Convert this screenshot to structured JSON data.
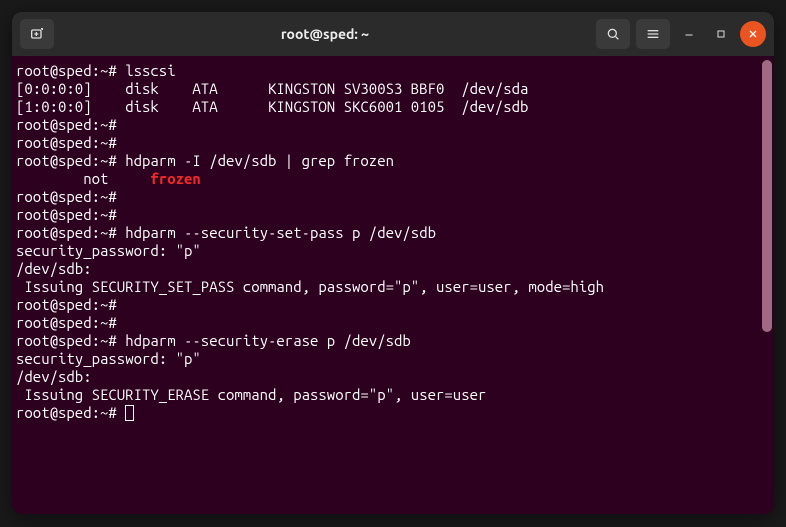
{
  "window": {
    "title": "root@sped: ~"
  },
  "icons": {
    "newtab": "new-tab",
    "search": "search",
    "menu": "menu",
    "minimize": "minimize",
    "maximize": "maximize",
    "close": "close"
  },
  "prompt": "root@sped:~# ",
  "lines": [
    {
      "type": "cmd",
      "text": "lsscsi"
    },
    {
      "type": "out",
      "text": "[0:0:0:0]    disk    ATA      KINGSTON SV300S3 BBF0  /dev/sda"
    },
    {
      "type": "out",
      "text": "[1:0:0:0]    disk    ATA      KINGSTON SKC6001 0105  /dev/sdb"
    },
    {
      "type": "cmd",
      "text": ""
    },
    {
      "type": "cmd",
      "text": ""
    },
    {
      "type": "cmd",
      "text": "hdparm -I /dev/sdb | grep frozen"
    },
    {
      "type": "grep",
      "pre": "        not     ",
      "match": "frozen"
    },
    {
      "type": "cmd",
      "text": ""
    },
    {
      "type": "cmd",
      "text": ""
    },
    {
      "type": "cmd",
      "text": "hdparm --security-set-pass p /dev/sdb"
    },
    {
      "type": "out",
      "text": "security_password: \"p\""
    },
    {
      "type": "out",
      "text": ""
    },
    {
      "type": "out",
      "text": "/dev/sdb:"
    },
    {
      "type": "out",
      "text": " Issuing SECURITY_SET_PASS command, password=\"p\", user=user, mode=high"
    },
    {
      "type": "cmd",
      "text": ""
    },
    {
      "type": "cmd",
      "text": ""
    },
    {
      "type": "cmd",
      "text": "hdparm --security-erase p /dev/sdb"
    },
    {
      "type": "out",
      "text": "security_password: \"p\""
    },
    {
      "type": "out",
      "text": ""
    },
    {
      "type": "out",
      "text": "/dev/sdb:"
    },
    {
      "type": "out",
      "text": " Issuing SECURITY_ERASE command, password=\"p\", user=user"
    },
    {
      "type": "cursor",
      "text": ""
    }
  ]
}
